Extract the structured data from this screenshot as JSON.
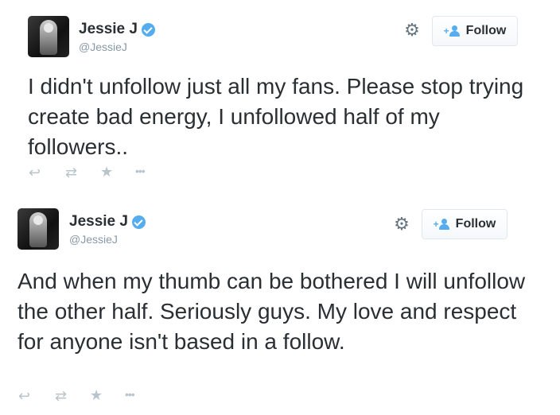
{
  "tweets": [
    {
      "display_name": "Jessie J",
      "handle": "@JessieJ",
      "follow_label": "Follow",
      "text": "I didn't unfollow just all my fans. Please stop trying create bad energy, I unfollowed half of my followers.."
    },
    {
      "display_name": "Jessie J",
      "handle": "@JessieJ",
      "follow_label": "Follow",
      "text": "And when my thumb can be bothered I will unfollow the other half. Seriously guys. My love and respect for anyone isn't based in a follow."
    }
  ],
  "icons": {
    "verified": "verified-badge-icon",
    "settings": "gear-icon",
    "follow": "add-user-icon",
    "reply": "reply-icon",
    "retweet": "retweet-icon",
    "favorite": "star-icon",
    "more": "more-icon"
  },
  "colors": {
    "accent": "#55acee",
    "text": "#292f33",
    "muted": "#8899a6",
    "action": "#b8c4cc"
  }
}
